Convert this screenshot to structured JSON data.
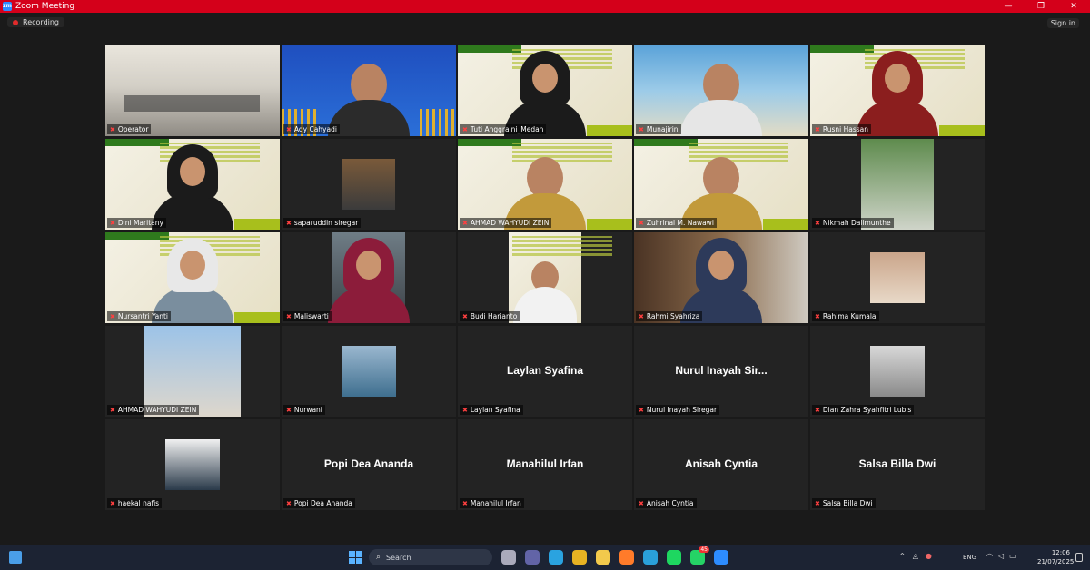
{
  "window": {
    "title": "Zoom Meeting",
    "app_icon": "zm"
  },
  "toolbar": {
    "recording": "Recording",
    "signin": "Sign in"
  },
  "participants": [
    {
      "name": "Operator",
      "kind": "office"
    },
    {
      "name": "Ady Cahyadi",
      "kind": "blue"
    },
    {
      "name": "Tuti Anggraini_Medan",
      "kind": "green-hijab"
    },
    {
      "name": "Munajirin",
      "kind": "beach"
    },
    {
      "name": "Rusni Hassan",
      "kind": "green-hijab-red"
    },
    {
      "name": "Dini Maritany",
      "kind": "green-hijab"
    },
    {
      "name": "saparuddin siregar",
      "kind": "photo"
    },
    {
      "name": "AHMAD WAHYUDI ZEIN",
      "kind": "green-man"
    },
    {
      "name": "Zuhrinal M. Nawawi",
      "kind": "green-man"
    },
    {
      "name": "Nikmah Dalimunthe",
      "kind": "photo-tall"
    },
    {
      "name": "Nursantri Yanti",
      "kind": "green-hijab-white"
    },
    {
      "name": "Maliswarti",
      "kind": "car"
    },
    {
      "name": "Budi Harianto",
      "kind": "green-man-white"
    },
    {
      "name": "Rahmi Syahriza",
      "kind": "room"
    },
    {
      "name": "Rahima Kumala",
      "kind": "photo-small"
    },
    {
      "name": "AHMAD WAHYUDI ZEIN",
      "kind": "photo-couple"
    },
    {
      "name": "Nurwani",
      "kind": "sea"
    },
    {
      "name": "Laylan Syafina",
      "kind": "text",
      "display": "Laylan Syafina"
    },
    {
      "name": "Nurul Inayah Siregar",
      "kind": "text",
      "display": "Nurul Inayah Sir..."
    },
    {
      "name": "Dian Zahra Syahfitri Lubis",
      "kind": "photo-pair"
    },
    {
      "name": "haekal nafis",
      "kind": "photo-man"
    },
    {
      "name": "Popi Dea Ananda",
      "kind": "text",
      "display": "Popi Dea Ananda"
    },
    {
      "name": "Manahilul Irfan",
      "kind": "text",
      "display": "Manahilul Irfan"
    },
    {
      "name": "Anisah Cyntia",
      "kind": "text",
      "display": "Anisah Cyntia"
    },
    {
      "name": "Salsa Billa Dwi",
      "kind": "text",
      "display": "Salsa Billa Dwi"
    }
  ],
  "taskbar": {
    "search_placeholder": "Search",
    "lang": "ENG",
    "time": "12:06",
    "date": "21/07/2025",
    "whatsapp_badge": "45",
    "apps": [
      "task-view",
      "teams",
      "edge",
      "chrome",
      "file-explorer",
      "firefox",
      "telegram",
      "spotify",
      "whatsapp",
      "zoom"
    ]
  },
  "colors": {
    "titlebar": "#d4001a",
    "active_border": "#c8e04a",
    "muted_mic": "#ff4040"
  }
}
